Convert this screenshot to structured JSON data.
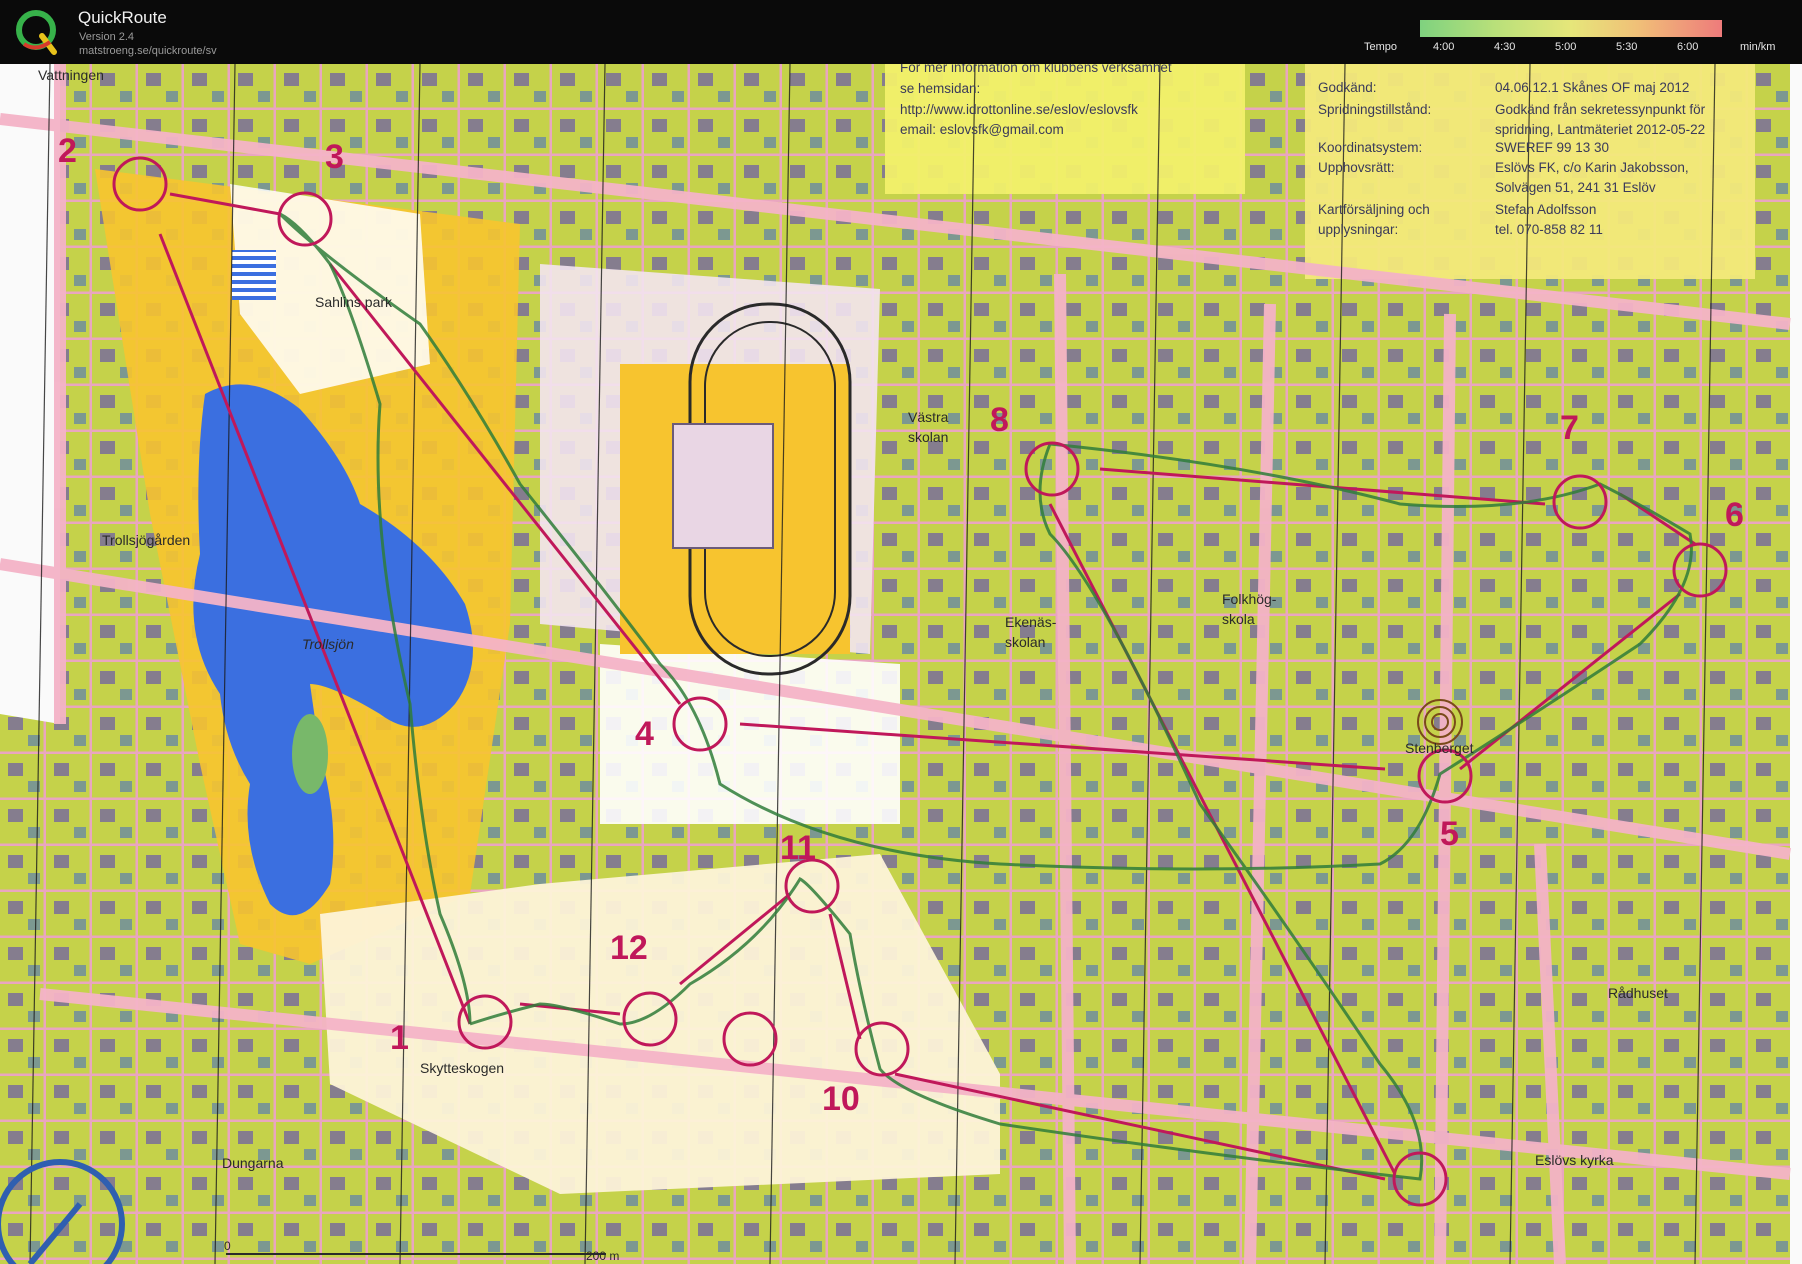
{
  "app": {
    "title": "QuickRoute",
    "version": "Version 2.4",
    "url": "matstroeng.se/quickroute/sv",
    "tempo_label": "Tempo",
    "tempo_ticks": [
      "4:00",
      "4:30",
      "5:00",
      "5:30",
      "6:00"
    ],
    "unit": "min/km"
  },
  "map": {
    "info_lines_left": [
      "För mer information om klubbens verksamhet",
      "se hemsidan:",
      "http://www.idrottonline.se/eslov/eslovsfk",
      "email: eslovsfk@gmail.com"
    ],
    "info_lines_right": [
      {
        "label": "Godkänd:",
        "value": "04.06.12.1 Skånes OF maj 2012"
      },
      {
        "label": "Spridningstillstånd:",
        "value": "Godkänd från sekretessynpunkt för"
      },
      {
        "label": "",
        "value": "spridning, Lantmäteriet 2012-05-22"
      },
      {
        "label": "Koordinatsystem:",
        "value": "SWEREF 99 13 30"
      },
      {
        "label": "Upphovsrätt:",
        "value": "Eslövs FK, c/o Karin Jakobsson,"
      },
      {
        "label": "",
        "value": "Solvägen 51, 241 31 Eslöv"
      },
      {
        "label": "Kartförsäljning och",
        "value": "Stefan Adolfsson"
      },
      {
        "label": "upplysningar:",
        "value": "tel. 070-858 82 11"
      }
    ],
    "place_names": [
      "Vattningen",
      "Sahlins park",
      "Trollsjögården",
      "Trollsjön",
      "Västra",
      "skolan",
      "Folkhög-",
      "skola",
      "Ekenäs-",
      "skolan",
      "Stenberget",
      "Skytteskogen",
      "Dungarna",
      "Rådhuset",
      "Eslövs kyrka"
    ],
    "scale_labels": [
      "0",
      "200 m"
    ],
    "controls": [
      "1",
      "2",
      "3",
      "4",
      "5",
      "6",
      "7",
      "8",
      "10",
      "11",
      "12"
    ],
    "colors": {
      "course": "#c0185a",
      "route": "#2f7d3a",
      "water": "#3b6fe0",
      "open_land": "#f7c42f",
      "residential": "#c8d44a",
      "road": "#f2b6c8"
    }
  }
}
